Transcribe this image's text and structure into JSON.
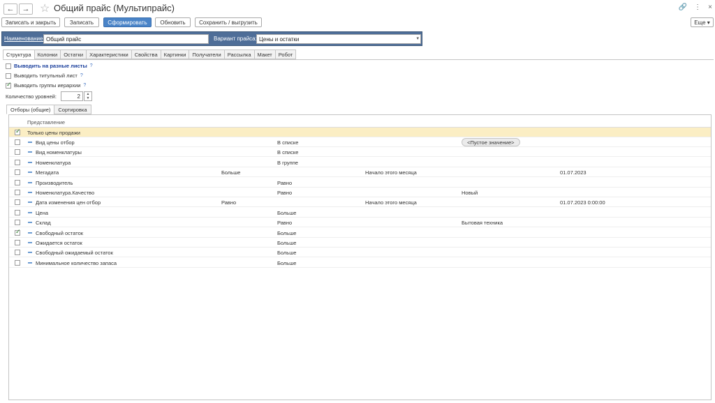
{
  "window": {
    "title": "Общий прайс (Мультипрайс)",
    "back_icon": "←",
    "forward_icon": "→",
    "more_label": "Еще"
  },
  "toolbar": {
    "save_close": "Записать и закрыть",
    "save": "Записать",
    "generate": "Сформировать",
    "refresh": "Обновить",
    "save_export": "Сохранить / выгрузить"
  },
  "filter": {
    "name_label": "Наименование:",
    "name_value": "Общий прайс",
    "variant_label": "Вариант прайса:",
    "variant_value": "Цены и остатки"
  },
  "tabs": [
    "Структура",
    "Колонки",
    "Остатки",
    "Характеристики",
    "Свойства",
    "Картинки",
    "Получатели",
    "Рассылка",
    "Макет",
    "Робот"
  ],
  "options": [
    {
      "label": "Выводить на разные листы",
      "q": "?",
      "checked": false
    },
    {
      "label": "Выводить титульный лист",
      "q": "?",
      "checked": false
    },
    {
      "label": "Выводить группы иерархии",
      "q": "?",
      "checked": true
    }
  ],
  "levels": {
    "label": "Количество уровней:",
    "value": "2"
  },
  "subtabs": [
    "Отборы (общие)",
    "Сортировка"
  ],
  "grid": {
    "header": "Представление",
    "group_row": "Только цены продажи",
    "rows": [
      {
        "name": "Вид цены отбор",
        "c1": "",
        "c2": "В списке",
        "c3": "",
        "c4": "<Пустое значение>",
        "c5": "",
        "checked": false
      },
      {
        "name": "Вид номенклатуры",
        "c1": "",
        "c2": "В списке",
        "c3": "",
        "c4": "",
        "c5": "",
        "checked": false
      },
      {
        "name": "Номенклатура",
        "c1": "",
        "c2": "В группе",
        "c3": "",
        "c4": "",
        "c5": "",
        "checked": false
      },
      {
        "name": "Мегадата",
        "c1": "Больше",
        "c2": "",
        "c3": "Начало этого месяца",
        "c4": "",
        "c5": "01.07.2023",
        "checked": false
      },
      {
        "name": "Производитель",
        "c1": "",
        "c2": "Равно",
        "c3": "",
        "c4": "",
        "c5": "",
        "checked": false
      },
      {
        "name": "Номенклатура.Качество",
        "c1": "",
        "c2": "Равно",
        "c3": "",
        "c4": "Новый",
        "c5": "",
        "checked": false
      },
      {
        "name": "Дата изменения цен отбор",
        "c1": "Равно",
        "c2": "",
        "c3": "Начало этого месяца",
        "c4": "",
        "c5": "01.07.2023 0:00:00",
        "checked": false
      },
      {
        "name": "Цена",
        "c1": "",
        "c2": "Больше",
        "c3": "",
        "c4": "",
        "c5": "",
        "checked": false
      },
      {
        "name": "Склад",
        "c1": "",
        "c2": "Равно",
        "c3": "",
        "c4": "Бытовая техника",
        "c5": "",
        "checked": false
      },
      {
        "name": "Свободный остаток",
        "c1": "",
        "c2": "Больше",
        "c3": "",
        "c4": "",
        "c5": "",
        "checked": true
      },
      {
        "name": "Ожидается остаток",
        "c1": "",
        "c2": "Больше",
        "c3": "",
        "c4": "",
        "c5": "",
        "checked": false
      },
      {
        "name": "Свободный ожидаемый остаток",
        "c1": "",
        "c2": "Больше",
        "c3": "",
        "c4": "",
        "c5": "",
        "checked": false
      },
      {
        "name": "Минимальное количество запаса",
        "c1": "",
        "c2": "Больше",
        "c3": "",
        "c4": "",
        "c5": "",
        "checked": false
      }
    ]
  }
}
